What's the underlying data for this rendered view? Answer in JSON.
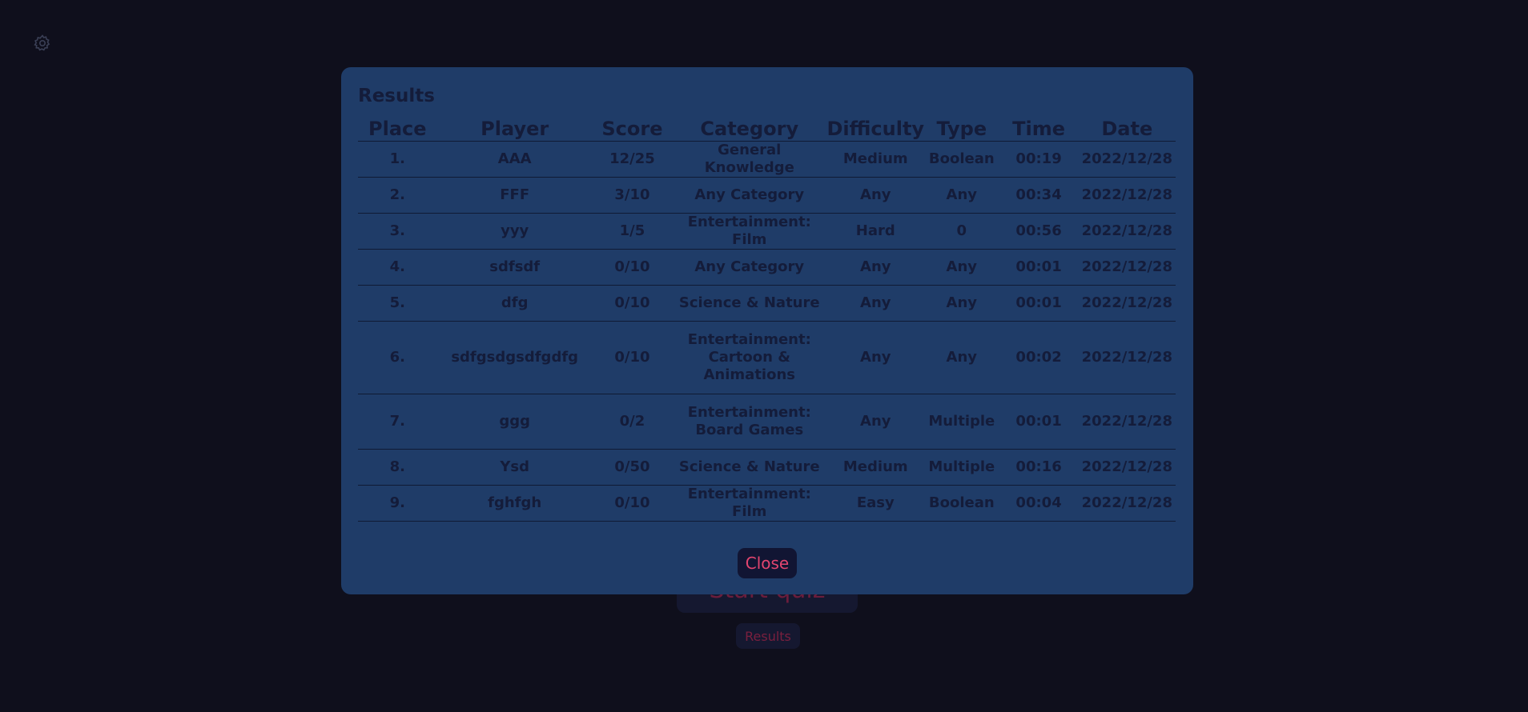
{
  "background": {
    "start_label": "Start quiz",
    "results_label": "Results"
  },
  "icons": {
    "settings": "gear-icon"
  },
  "modal": {
    "title": "Results",
    "close_label": "Close",
    "columns": [
      "Place",
      "Player",
      "Score",
      "Category",
      "Difficulty",
      "Type",
      "Time",
      "Date"
    ],
    "rows": [
      [
        "1.",
        "AAA",
        "12/25",
        "General Knowledge",
        "Medium",
        "Boolean",
        "00:19",
        "2022/12/28"
      ],
      [
        "2.",
        "FFF",
        "3/10",
        "Any Category",
        "Any",
        "Any",
        "00:34",
        "2022/12/28"
      ],
      [
        "3.",
        "yyy",
        "1/5",
        "Entertainment: Film",
        "Hard",
        "0",
        "00:56",
        "2022/12/28"
      ],
      [
        "4.",
        "sdfsdf",
        "0/10",
        "Any Category",
        "Any",
        "Any",
        "00:01",
        "2022/12/28"
      ],
      [
        "5.",
        "dfg",
        "0/10",
        "Science & Nature",
        "Any",
        "Any",
        "00:01",
        "2022/12/28"
      ],
      [
        "6.",
        "sdfgsdgsdfgdfg",
        "0/10",
        "Entertainment: Cartoon & Animations",
        "Any",
        "Any",
        "00:02",
        "2022/12/28"
      ],
      [
        "7.",
        "ggg",
        "0/2",
        "Entertainment: Board Games",
        "Any",
        "Multiple",
        "00:01",
        "2022/12/28"
      ],
      [
        "8.",
        "Ysd",
        "0/50",
        "Science & Nature",
        "Medium",
        "Multiple",
        "00:16",
        "2022/12/28"
      ],
      [
        "9.",
        "fghfgh",
        "0/10",
        "Entertainment: Film",
        "Easy",
        "Boolean",
        "00:04",
        "2022/12/28"
      ]
    ]
  },
  "colors": {
    "page_bg": "#0f0f1c",
    "modal_bg": "#1f3c68",
    "text_dark": "#141c3a",
    "accent_pink": "#e2456f"
  }
}
